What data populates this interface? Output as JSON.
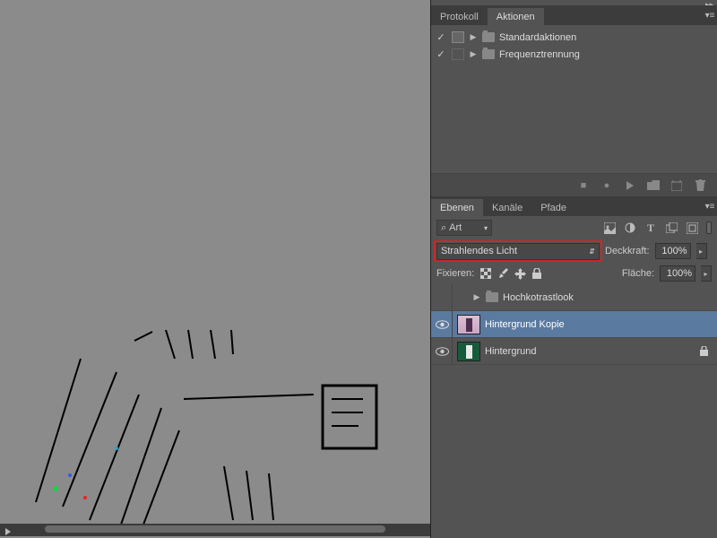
{
  "panels": {
    "history_tab": "Protokoll",
    "actions_tab": "Aktionen"
  },
  "actions": {
    "items": [
      {
        "label": "Standardaktionen",
        "checked": true,
        "dialog": true
      },
      {
        "label": "Frequenztrennung",
        "checked": true,
        "dialog": false
      }
    ]
  },
  "layers_tabs": {
    "layers": "Ebenen",
    "channels": "Kanäle",
    "paths": "Pfade"
  },
  "filter": {
    "kind_label": "Art"
  },
  "blend": {
    "mode": "Strahlendes Licht",
    "opacity_label": "Deckkraft:",
    "opacity_value": "100%"
  },
  "lock": {
    "label": "Fixieren:",
    "fill_label": "Fläche:",
    "fill_value": "100%"
  },
  "layers": [
    {
      "name": "Hochkotrastlook",
      "type": "group",
      "visible": false
    },
    {
      "name": "Hintergrund Kopie",
      "type": "layer",
      "visible": true,
      "selected": true,
      "thumb": "pink"
    },
    {
      "name": "Hintergrund",
      "type": "layer",
      "visible": true,
      "locked": true,
      "thumb": "green"
    }
  ]
}
